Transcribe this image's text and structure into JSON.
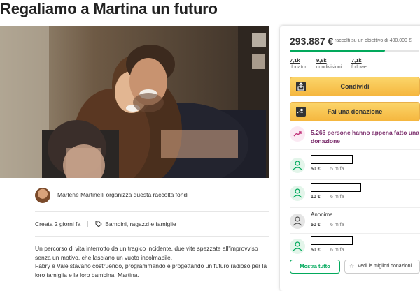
{
  "page": {
    "title": "Regaliamo a Martina un futuro"
  },
  "organizer": {
    "text": "Marlene Martinelli organizza questa raccolta fondi"
  },
  "meta": {
    "created": "Creata 2 giorni fa",
    "category": "Bambini, ragazzi e famiglie"
  },
  "story": {
    "p1": "Un percorso di vita interrotto da un tragico incidente, due vite spezzate all'improvviso senza un motivo, che lasciano un vuoto incolmabile.",
    "p2": "Fabry e Vale stavano costruendo, programmando e progettando un futuro radioso per la loro famiglia e la loro bambina, Martina."
  },
  "fundraiser": {
    "raised": "293.887 €",
    "goal_text": "raccolti su un obiettivo di 400.000 €",
    "progress_fraction": 0.735,
    "stats": [
      {
        "value": "7,1k",
        "label": "donatori"
      },
      {
        "value": "9,6k",
        "label": "condivisioni"
      },
      {
        "value": "7,1k",
        "label": "follower"
      }
    ],
    "share_label": "Condividi",
    "donate_label": "Fai una donazione",
    "trending_text": "5.266 persone hanno appena fatto una donazione",
    "donations": [
      {
        "name": "",
        "amount": "50 €",
        "time": "5 m fa",
        "anonymous": false
      },
      {
        "name": "",
        "amount": "10 €",
        "time": "6 m fa",
        "anonymous": false
      },
      {
        "name": "Anonima",
        "amount": "50 €",
        "time": "6 m fa",
        "anonymous": true
      },
      {
        "name": "",
        "amount": "50 €",
        "time": "6 m fa",
        "anonymous": false
      }
    ],
    "show_all_label": "Mostra tutto",
    "top_donations_label": "Vedi le migliori donazioni"
  },
  "colors": {
    "accent_green": "#02a95c",
    "button_yellow": "#f5b73f",
    "trend_purple": "#7a2c6b"
  },
  "icons": {
    "share": "share-icon",
    "donate": "donate-icon",
    "trend": "trending-up-icon",
    "donor": "user-heart-icon",
    "tag": "tag-icon",
    "star": "star-icon"
  }
}
